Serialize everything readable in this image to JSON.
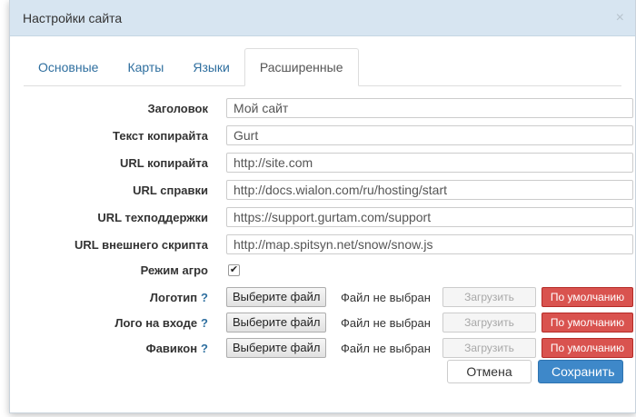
{
  "dialog": {
    "title": "Настройки сайта",
    "close_label": "×"
  },
  "tabs": [
    {
      "label": "Основные"
    },
    {
      "label": "Карты"
    },
    {
      "label": "Языки"
    },
    {
      "label": "Расширенные",
      "active": true
    }
  ],
  "fields": {
    "title": {
      "label": "Заголовок",
      "value": "Мой сайт"
    },
    "copyright_text": {
      "label": "Текст копирайта",
      "value": "Gurt"
    },
    "copyright_url": {
      "label": "URL копирайта",
      "value": "http://site.com"
    },
    "help_url": {
      "label": "URL справки",
      "value": "http://docs.wialon.com/ru/hosting/start"
    },
    "support_url": {
      "label": "URL техподдержки",
      "value": "https://support.gurtam.com/support"
    },
    "external_script_url": {
      "label": "URL внешнего скрипта",
      "value": "http://map.spitsyn.net/snow/snow.js"
    },
    "agro_mode": {
      "label": "Режим агро",
      "checked": true,
      "mark": "✔"
    }
  },
  "files": {
    "logo": {
      "label": "Логотип",
      "help": "?",
      "choose": "Выберите файл",
      "status": "Файл не выбран",
      "upload": "Загрузить",
      "default": "По умолчанию"
    },
    "login_logo": {
      "label": "Лого на входе",
      "help": "?",
      "choose": "Выберите файл",
      "status": "Файл не выбран",
      "upload": "Загрузить",
      "default": "По умолчанию"
    },
    "favicon": {
      "label": "Фавикон",
      "help": "?",
      "choose": "Выберите файл",
      "status": "Файл не выбран",
      "upload": "Загрузить",
      "default": "По умолчанию"
    }
  },
  "footer": {
    "cancel_label": "Отмена",
    "save_label": "Сохранить"
  },
  "colors": {
    "titlebar": "#d7e5f1",
    "link": "#2f6f9f",
    "danger": "#d9534f",
    "primary": "#3e88c9"
  }
}
